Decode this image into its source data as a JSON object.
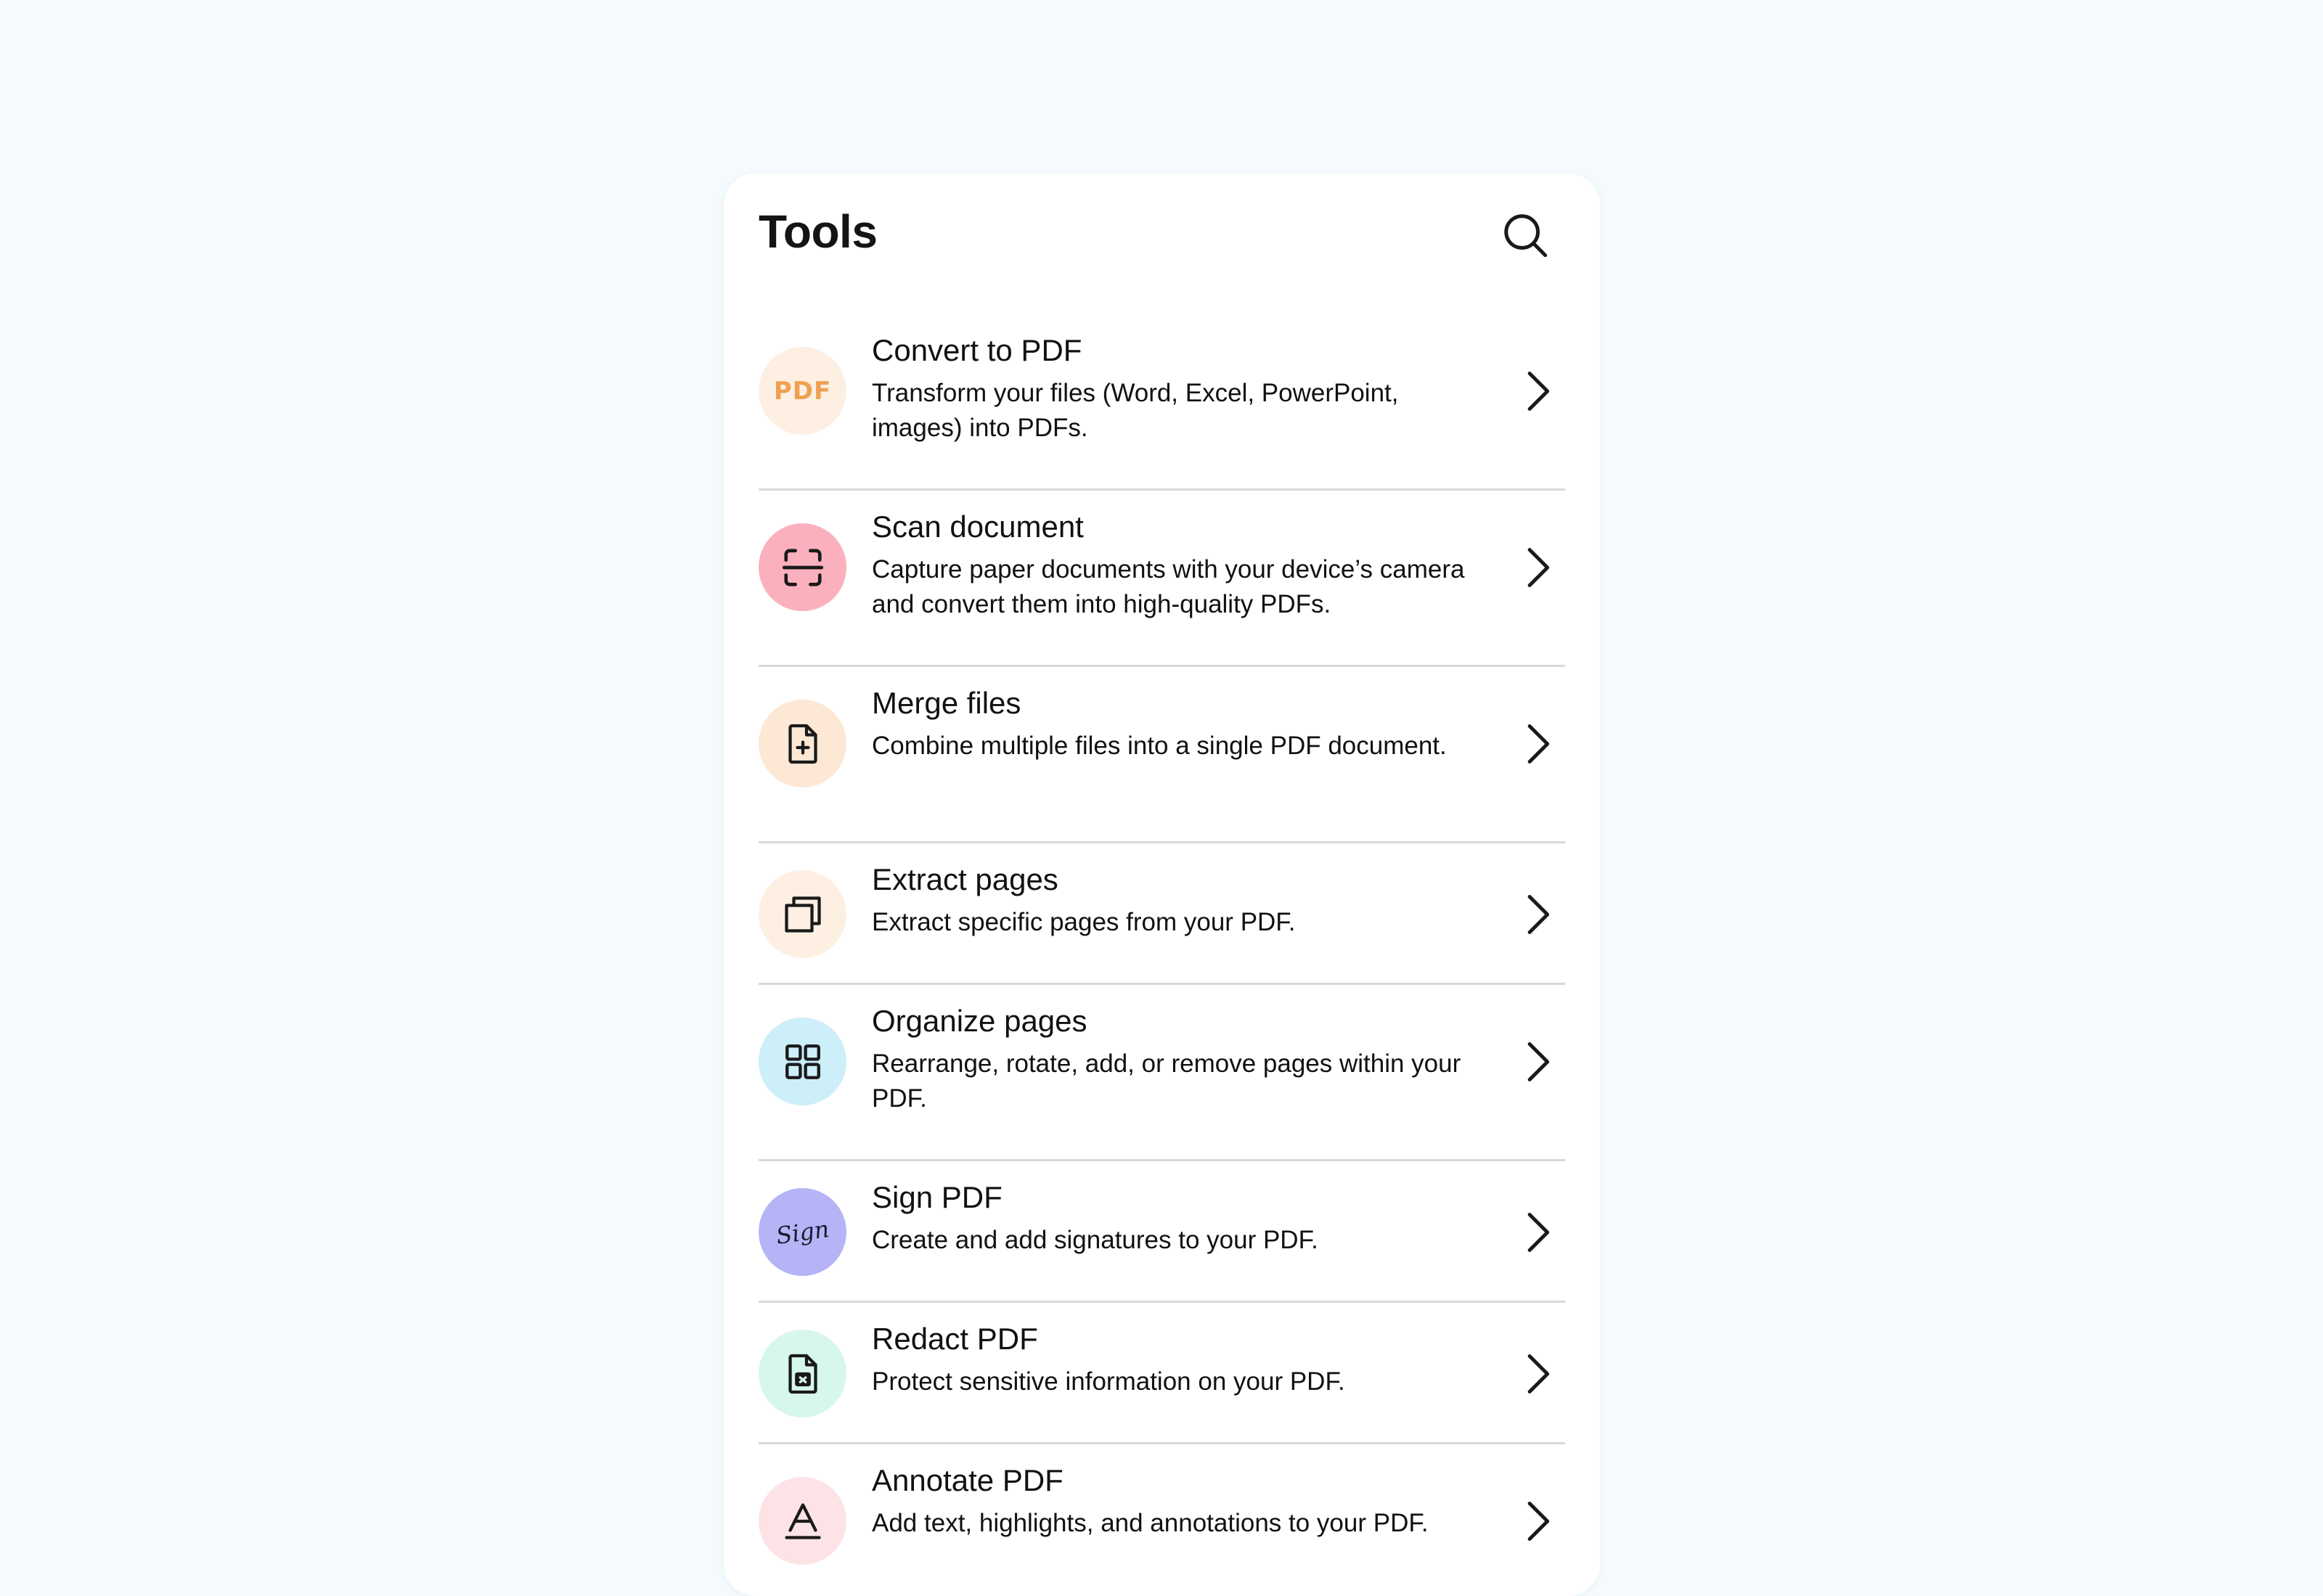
{
  "header": {
    "title": "Tools",
    "search_icon": "search-icon"
  },
  "tools": [
    {
      "id": "convert-to-pdf",
      "title": "Convert to PDF",
      "description": "Transform your files (Word, Excel, PowerPoint, images) into PDFs.",
      "icon": "pdf-icon",
      "icon_text": "PDF",
      "icon_bg": "#fdf0e3",
      "icon_color": "#f0a050"
    },
    {
      "id": "scan-document",
      "title": "Scan document",
      "description": "Capture paper documents with your device’s camera and convert them into high-quality PDFs.",
      "icon": "scan-icon",
      "icon_bg": "#fbb1bd"
    },
    {
      "id": "merge-files",
      "title": "Merge files",
      "description": "Combine multiple files into a single PDF document.",
      "icon": "file-plus-icon",
      "icon_bg": "#fde8d5"
    },
    {
      "id": "extract-pages",
      "title": "Extract pages",
      "description": "Extract specific pages from your PDF.",
      "icon": "copy-pages-icon",
      "icon_bg": "#fdf0e3"
    },
    {
      "id": "organize-pages",
      "title": "Organize pages",
      "description": "Rearrange, rotate, add, or remove pages within your PDF.",
      "icon": "grid-icon",
      "icon_bg": "#cdeffa"
    },
    {
      "id": "sign-pdf",
      "title": "Sign PDF",
      "description": "Create and add signatures to your PDF.",
      "icon": "signature-icon",
      "icon_text": "Sign",
      "icon_bg": "#b6b3f7"
    },
    {
      "id": "redact-pdf",
      "title": "Redact PDF",
      "description": "Protect sensitive information on your PDF.",
      "icon": "file-redact-icon",
      "icon_bg": "#d7f7ee"
    },
    {
      "id": "annotate-pdf",
      "title": "Annotate PDF",
      "description": "Add text, highlights, and annotations to your PDF.",
      "icon": "text-annotate-icon",
      "icon_bg": "#fde3e6"
    }
  ]
}
